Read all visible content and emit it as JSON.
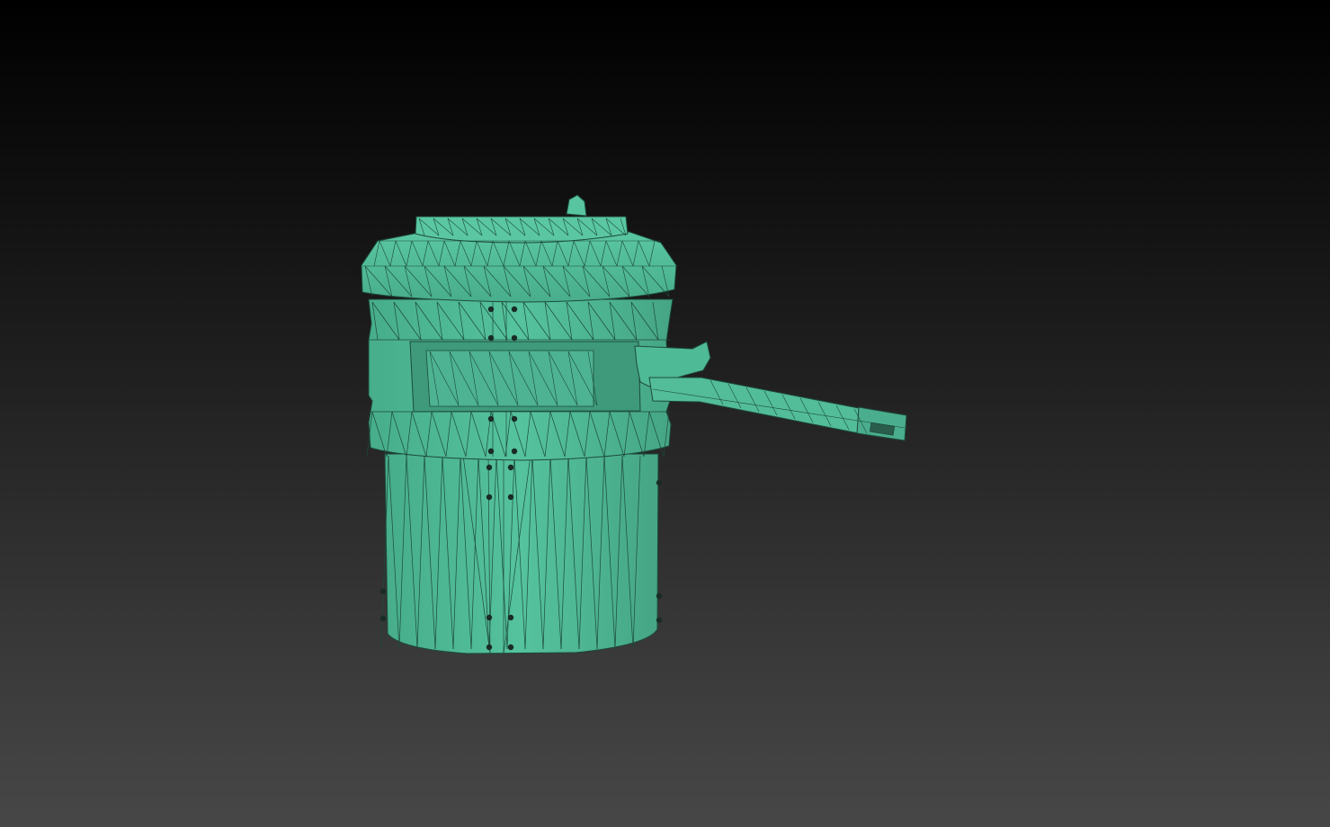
{
  "viewport": {
    "background_top": "#000000",
    "background_bottom": "#474747"
  },
  "model": {
    "subject": "turret-mesh",
    "display_mode": "wireframe-on-shaded",
    "fill_color": "#4fba96",
    "fill_shade_color": "#3f9c7c",
    "wire_color": "#1d4a3b",
    "bolt_color": "#1a2b25"
  }
}
